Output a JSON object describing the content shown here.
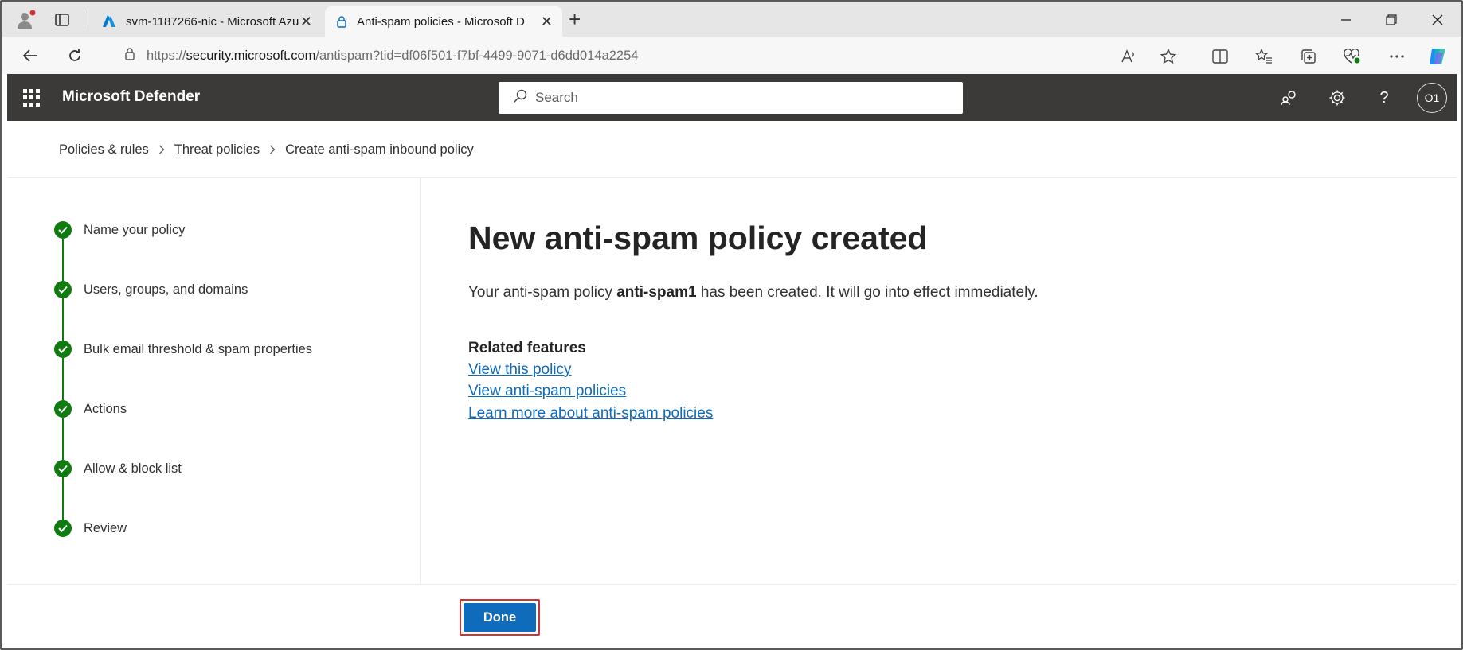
{
  "browser": {
    "tabs": [
      {
        "title": "svm-1187266-nic - Microsoft Azu",
        "close": "✕"
      },
      {
        "title": "Anti-spam policies - Microsoft D",
        "close": "✕"
      }
    ],
    "new_tab": "+",
    "url_prefix": "https://",
    "url_host": "security.microsoft.com",
    "url_path": "/antispam?tid=df06f501-f7bf-4499-9071-d6dd014a2254"
  },
  "app": {
    "title": "Microsoft Defender",
    "search_placeholder": "Search",
    "help": "?",
    "avatar_initials": "O1"
  },
  "breadcrumb": {
    "items": [
      "Policies & rules",
      "Threat policies",
      "Create anti-spam inbound policy"
    ]
  },
  "wizard": {
    "steps": [
      {
        "label": "Name your policy",
        "status": "complete"
      },
      {
        "label": "Users, groups, and domains",
        "status": "complete"
      },
      {
        "label": "Bulk email threshold & spam properties",
        "status": "complete"
      },
      {
        "label": "Actions",
        "status": "complete"
      },
      {
        "label": "Allow & block list",
        "status": "complete"
      },
      {
        "label": "Review",
        "status": "complete"
      }
    ]
  },
  "main": {
    "title": "New anti-spam policy created",
    "desc_before": "Your anti-spam policy ",
    "policy_name": "anti-spam1",
    "desc_after": " has been created. It will go into effect immediately.",
    "related_heading": "Related features",
    "links": [
      "View this policy",
      "View anti-spam policies",
      "Learn more about anti-spam policies"
    ]
  },
  "footer": {
    "done_label": "Done"
  },
  "colors": {
    "accent": "#0f6cbd",
    "success": "#107c10",
    "header_bg": "#3b3a39",
    "highlight": "#d13438"
  }
}
